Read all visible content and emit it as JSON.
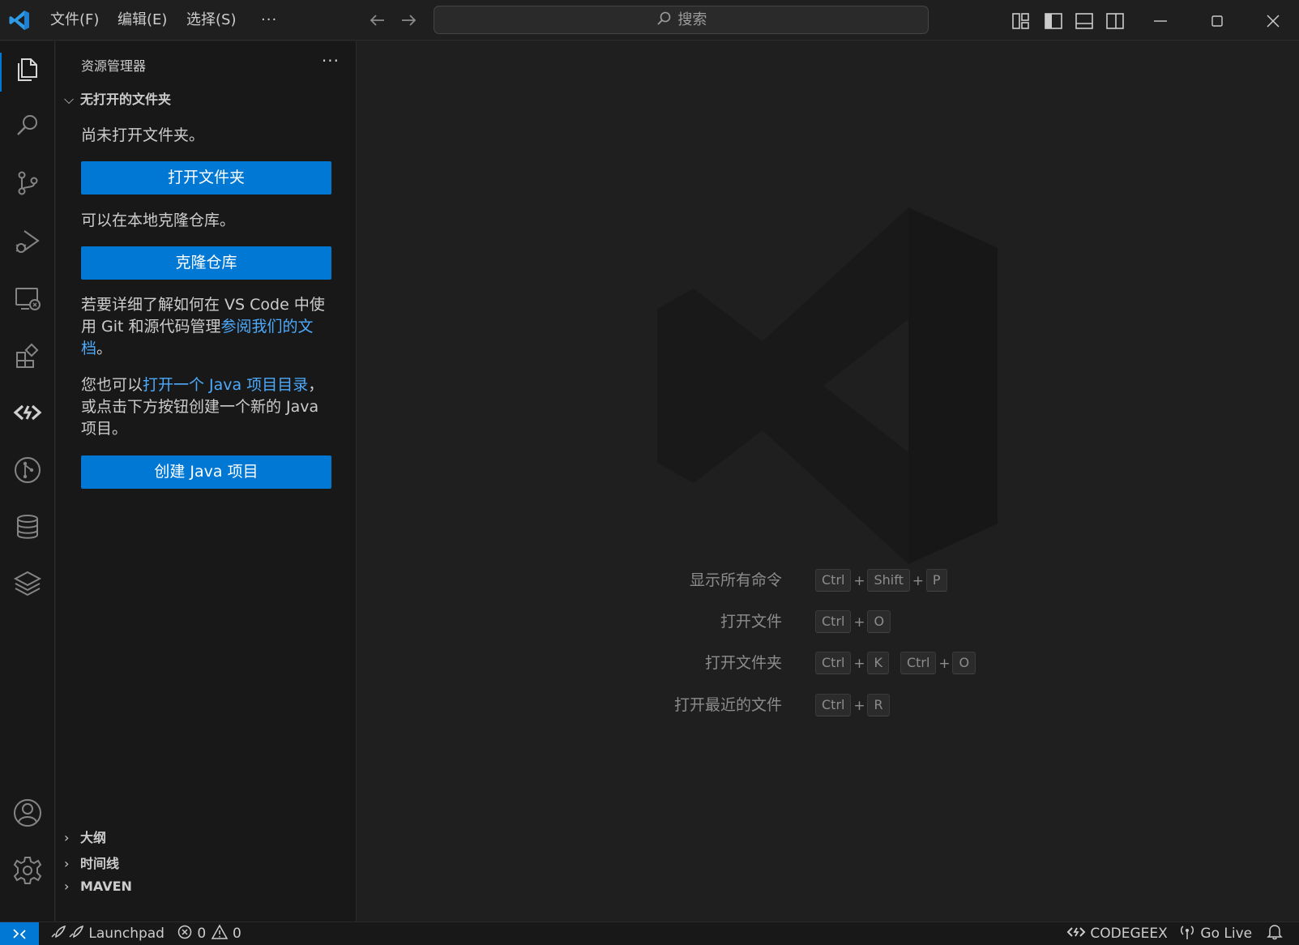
{
  "titlebar": {
    "menus": [
      "文件(F)",
      "编辑(E)",
      "选择(S)",
      "···"
    ],
    "back_icon": "arrow-left-icon",
    "forward_icon": "arrow-right-icon",
    "search_placeholder": "搜索",
    "accent": "#0078d4"
  },
  "activitybar": {
    "items": [
      "explorer-icon",
      "search-icon",
      "source-control-icon",
      "run-debug-icon",
      "remote-explorer-icon",
      "extensions-icon",
      "codegeex-icon",
      "git-graph-icon",
      "database-icon",
      "layers-icon"
    ],
    "bottom": [
      "account-icon",
      "settings-gear-icon"
    ]
  },
  "sidebar": {
    "title": "资源管理器",
    "more": "···",
    "section": "无打开的文件夹",
    "no_folder_text": "尚未打开文件夹。",
    "open_folder_button": "打开文件夹",
    "clone_text": "可以在本地克隆仓库。",
    "clone_button": "克隆仓库",
    "learn_text_1": "若要详细了解如何在 VS Code 中使用 Git 和源代码管理",
    "learn_link": "参阅我们的文档",
    "learn_text_2": "。",
    "java_text_1": "您也可以",
    "java_link": "打开一个 Java 项目目录",
    "java_text_2": "，或点击下方按钮创建一个新的 Java 项目。",
    "java_button": "创建 Java 项目",
    "bottom_sections": [
      "大纲",
      "时间线",
      "MAVEN"
    ]
  },
  "editor": {
    "shortcuts": [
      {
        "label": "显示所有命令",
        "keys": [
          "Ctrl",
          "Shift",
          "P"
        ]
      },
      {
        "label": "打开文件",
        "keys": [
          "Ctrl",
          "O"
        ]
      },
      {
        "label": "打开文件夹",
        "keys": [
          "Ctrl",
          "K"
        ],
        "keys2": [
          "Ctrl",
          "O"
        ]
      },
      {
        "label": "打开最近的文件",
        "keys": [
          "Ctrl",
          "R"
        ]
      }
    ]
  },
  "statusbar": {
    "launchpad": "Launchpad",
    "errors": "0",
    "warnings": "0",
    "codegeex": "CODEGEEX",
    "golive": "Go Live"
  }
}
